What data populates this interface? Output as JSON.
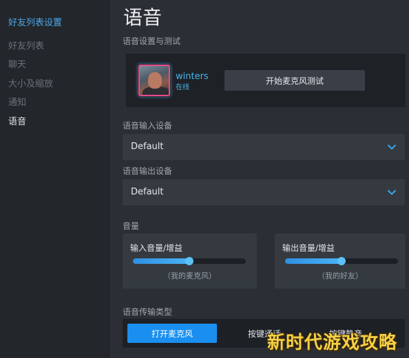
{
  "sidebar": {
    "heading": "好友列表设置",
    "items": [
      {
        "label": "好友列表"
      },
      {
        "label": "聊天"
      },
      {
        "label": "大小及缩放"
      },
      {
        "label": "通知"
      },
      {
        "label": "语音"
      }
    ],
    "active_item": "语音"
  },
  "main": {
    "title": "语音",
    "test_section": {
      "label": "语音设置与测试",
      "user": {
        "name": "winters",
        "status": "在线"
      },
      "mic_test_button": "开始麦克风测试"
    },
    "input_device": {
      "label": "语音输入设备",
      "value": "Default"
    },
    "output_device": {
      "label": "语音输出设备",
      "value": "Default"
    },
    "volume": {
      "label": "音量",
      "input": {
        "label": "输入音量/增益",
        "sub": "（我的麦克风）",
        "level": 0.5
      },
      "output": {
        "label": "输出音量/增益",
        "sub": "（我的好友）",
        "level": 0.5
      }
    },
    "transmission": {
      "label": "语音传输类型",
      "options": [
        "打开麦克风",
        "按键通话",
        "按键静音"
      ],
      "selected": "打开麦克风"
    }
  },
  "watermark": "新时代游戏攻略",
  "colors": {
    "accent": "#1a8ff0",
    "link": "#4ab4ee",
    "sidebar_heading": "#4aa8ea",
    "avatar_border": "#e94b8c",
    "watermark": "#f6d043"
  },
  "icons": {
    "dropdown": "chevron-down-icon"
  }
}
